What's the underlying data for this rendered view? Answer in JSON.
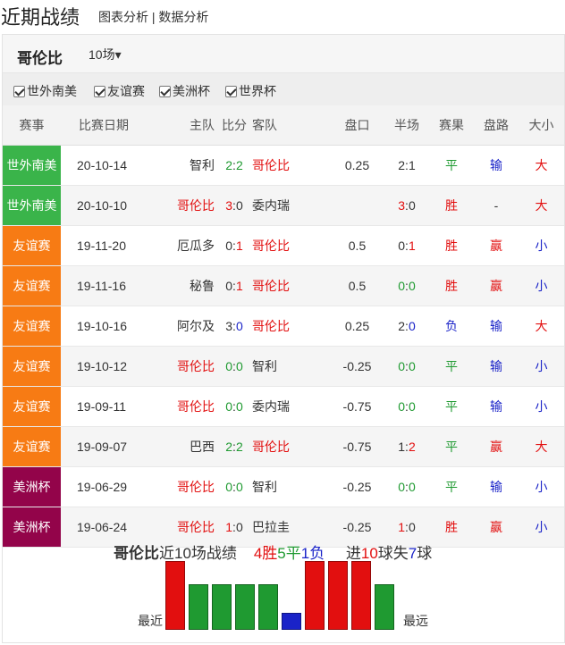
{
  "header": {
    "title": "近期战绩",
    "tab1": "图表分析",
    "sep": " | ",
    "tab2": "数据分析"
  },
  "team": {
    "name": "哥伦比",
    "select_label": "10场",
    "caret": "▾"
  },
  "filters": [
    "世外南美",
    "友谊赛",
    "美洲杯",
    "世界杯"
  ],
  "columns": [
    "赛事",
    "比赛日期",
    "主队",
    "比分",
    "客队",
    "盘口",
    "半场",
    "赛果",
    "盘路",
    "大小"
  ],
  "colors": {
    "wc_qual": "#3ab44a",
    "friendly": "#f77b14",
    "copa": "#93044a",
    "win": "#e20f0f",
    "draw": "#1f9a31",
    "loss": "#1a23c8"
  },
  "matches": [
    {
      "league": "世外南美",
      "lc": "green",
      "date": "20-10-14",
      "home": "智利",
      "hc": "dark",
      "s1": "2",
      "sep": ":",
      "s2": "2",
      "sc1": "green",
      "sc2": "green",
      "away": "哥伦比",
      "ac": "red",
      "hcap": "0.25",
      "ht1": "2",
      "ht2": "1",
      "htc1": "dark",
      "htc2": "dark",
      "res": "平",
      "rc": "green",
      "pan": "输",
      "pc": "blue",
      "ou": "大",
      "oc": "red",
      "bg": ""
    },
    {
      "league": "世外南美",
      "lc": "green",
      "date": "20-10-10",
      "home": "哥伦比",
      "hc": "red",
      "s1": "3",
      "sep": ":",
      "s2": "0",
      "sc1": "red",
      "sc2": "dark",
      "away": "委内瑞",
      "ac": "dark",
      "hcap": "",
      "ht1": "3",
      "ht2": "0",
      "htc1": "red",
      "htc2": "dark",
      "res": "胜",
      "rc": "red",
      "pan": "-",
      "pc": "dark",
      "ou": "大",
      "oc": "red",
      "bg": "gray"
    },
    {
      "league": "友谊赛",
      "lc": "orange",
      "date": "19-11-20",
      "home": "厄瓜多",
      "hc": "dark",
      "s1": "0",
      "sep": ":",
      "s2": "1",
      "sc1": "dark",
      "sc2": "red",
      "away": "哥伦比",
      "ac": "red",
      "hcap": "0.5",
      "ht1": "0",
      "ht2": "1",
      "htc1": "dark",
      "htc2": "red",
      "res": "胜",
      "rc": "red",
      "pan": "赢",
      "pc": "red",
      "ou": "小",
      "oc": "blue",
      "bg": ""
    },
    {
      "league": "友谊赛",
      "lc": "orange",
      "date": "19-11-16",
      "home": "秘鲁",
      "hc": "dark",
      "s1": "0",
      "sep": ":",
      "s2": "1",
      "sc1": "dark",
      "sc2": "red",
      "away": "哥伦比",
      "ac": "red",
      "hcap": "0.5",
      "ht1": "0",
      "ht2": "0",
      "htc1": "green",
      "htc2": "green",
      "res": "胜",
      "rc": "red",
      "pan": "赢",
      "pc": "red",
      "ou": "小",
      "oc": "blue",
      "bg": "gray"
    },
    {
      "league": "友谊赛",
      "lc": "orange",
      "date": "19-10-16",
      "home": "阿尔及",
      "hc": "dark",
      "s1": "3",
      "sep": ":",
      "s2": "0",
      "sc1": "dark",
      "sc2": "blue",
      "away": "哥伦比",
      "ac": "red",
      "hcap": "0.25",
      "ht1": "2",
      "ht2": "0",
      "htc1": "dark",
      "htc2": "blue",
      "res": "负",
      "rc": "blue",
      "pan": "输",
      "pc": "blue",
      "ou": "大",
      "oc": "red",
      "bg": ""
    },
    {
      "league": "友谊赛",
      "lc": "orange",
      "date": "19-10-12",
      "home": "哥伦比",
      "hc": "red",
      "s1": "0",
      "sep": ":",
      "s2": "0",
      "sc1": "green",
      "sc2": "green",
      "away": "智利",
      "ac": "dark",
      "hcap": "-0.25",
      "ht1": "0",
      "ht2": "0",
      "htc1": "green",
      "htc2": "green",
      "res": "平",
      "rc": "green",
      "pan": "输",
      "pc": "blue",
      "ou": "小",
      "oc": "blue",
      "bg": "gray"
    },
    {
      "league": "友谊赛",
      "lc": "orange",
      "date": "19-09-11",
      "home": "哥伦比",
      "hc": "red",
      "s1": "0",
      "sep": ":",
      "s2": "0",
      "sc1": "green",
      "sc2": "green",
      "away": "委内瑞",
      "ac": "dark",
      "hcap": "-0.75",
      "ht1": "0",
      "ht2": "0",
      "htc1": "green",
      "htc2": "green",
      "res": "平",
      "rc": "green",
      "pan": "输",
      "pc": "blue",
      "ou": "小",
      "oc": "blue",
      "bg": ""
    },
    {
      "league": "友谊赛",
      "lc": "orange",
      "date": "19-09-07",
      "home": "巴西",
      "hc": "dark",
      "s1": "2",
      "sep": ":",
      "s2": "2",
      "sc1": "green",
      "sc2": "green",
      "away": "哥伦比",
      "ac": "red",
      "hcap": "-0.75",
      "ht1": "1",
      "ht2": "2",
      "htc1": "dark",
      "htc2": "red",
      "res": "平",
      "rc": "green",
      "pan": "赢",
      "pc": "red",
      "ou": "大",
      "oc": "red",
      "bg": "gray"
    },
    {
      "league": "美洲杯",
      "lc": "maroon",
      "date": "19-06-29",
      "home": "哥伦比",
      "hc": "red",
      "s1": "0",
      "sep": ":",
      "s2": "0",
      "sc1": "green",
      "sc2": "green",
      "away": "智利",
      "ac": "dark",
      "hcap": "-0.25",
      "ht1": "0",
      "ht2": "0",
      "htc1": "green",
      "htc2": "green",
      "res": "平",
      "rc": "green",
      "pan": "输",
      "pc": "blue",
      "ou": "小",
      "oc": "blue",
      "bg": ""
    },
    {
      "league": "美洲杯",
      "lc": "maroon",
      "date": "19-06-24",
      "home": "哥伦比",
      "hc": "red",
      "s1": "1",
      "sep": ":",
      "s2": "0",
      "sc1": "red",
      "sc2": "dark",
      "away": "巴拉圭",
      "ac": "dark",
      "hcap": "-0.25",
      "ht1": "1",
      "ht2": "0",
      "htc1": "red",
      "htc2": "dark",
      "res": "胜",
      "rc": "red",
      "pan": "赢",
      "pc": "red",
      "ou": "小",
      "oc": "blue",
      "bg": "gray"
    }
  ],
  "summary": {
    "team": "哥伦比",
    "text1": "近10场战绩",
    "w": "4",
    "wl": "胜",
    "d": "5",
    "dl": "平",
    "l": "1",
    "ll": "负",
    "gf_pre": "进",
    "gf": "10",
    "gf_mid": "球失",
    "ga": "7",
    "ga_post": "球",
    "recent": "最近",
    "distant": "最远"
  },
  "chart_data": {
    "type": "bar",
    "categories": [
      "20-10-14",
      "20-10-10",
      "19-11-20",
      "19-11-16",
      "19-10-16",
      "19-10-12",
      "19-09-11",
      "19-09-07",
      "19-06-29",
      "19-06-24"
    ],
    "order": "most recent first (displayed right to left)",
    "values": [
      "平",
      "胜",
      "胜",
      "胜",
      "负",
      "平",
      "平",
      "平",
      "平",
      "胜"
    ],
    "levels": {
      "胜": 1.0,
      "平": 0.66,
      "负": 0.25
    }
  }
}
